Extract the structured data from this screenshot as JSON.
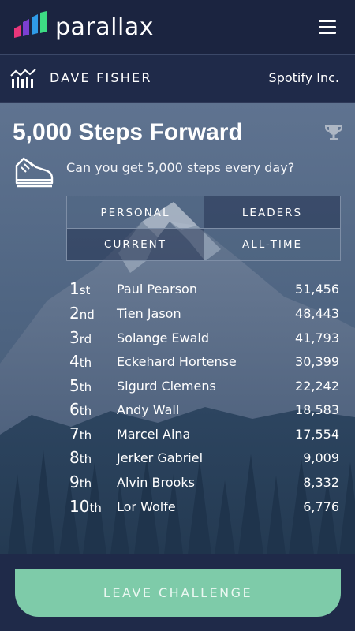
{
  "header": {
    "brand": "parallax",
    "menu_icon": "hamburger-menu-icon"
  },
  "user": {
    "name": "DAVE FISHER",
    "company": "Spotify Inc.",
    "icon": "stats-icon"
  },
  "challenge": {
    "title": "5,000 Steps Forward",
    "description": "Can you get 5,000 steps every day?",
    "icons": [
      "trophy-icon",
      "shoe-icon"
    ]
  },
  "filters": {
    "personal": "PERSONAL",
    "leaders": "LEADERS",
    "current": "CURRENT",
    "all_time": "ALL-TIME"
  },
  "leaderboard": [
    {
      "rank": "1",
      "suffix": "st",
      "name": "Paul Pearson",
      "score": "51,456"
    },
    {
      "rank": "2",
      "suffix": "nd",
      "name": "Tien Jason",
      "score": "48,443"
    },
    {
      "rank": "3",
      "suffix": "rd",
      "name": "Solange Ewald",
      "score": "41,793"
    },
    {
      "rank": "4",
      "suffix": "th",
      "name": "Eckehard Hortense",
      "score": "30,399"
    },
    {
      "rank": "5",
      "suffix": "th",
      "name": "Sigurd Clemens",
      "score": "22,242"
    },
    {
      "rank": "6",
      "suffix": "th",
      "name": "Andy Wall",
      "score": "18,583"
    },
    {
      "rank": "7",
      "suffix": "th",
      "name": "Marcel Aina",
      "score": "17,554"
    },
    {
      "rank": "8",
      "suffix": "th",
      "name": "Jerker Gabriel",
      "score": "9,009"
    },
    {
      "rank": "9",
      "suffix": "th",
      "name": "Alvin Brooks",
      "score": "8,332"
    },
    {
      "rank": "10",
      "suffix": "th",
      "name": "Lor Wolfe",
      "score": "6,776"
    }
  ],
  "footer": {
    "leave_label": "LEAVE CHALLENGE"
  },
  "colors": {
    "accent": "#7ecba9",
    "header_bg": "#1b2440",
    "userbar_bg": "#1f2a49"
  }
}
